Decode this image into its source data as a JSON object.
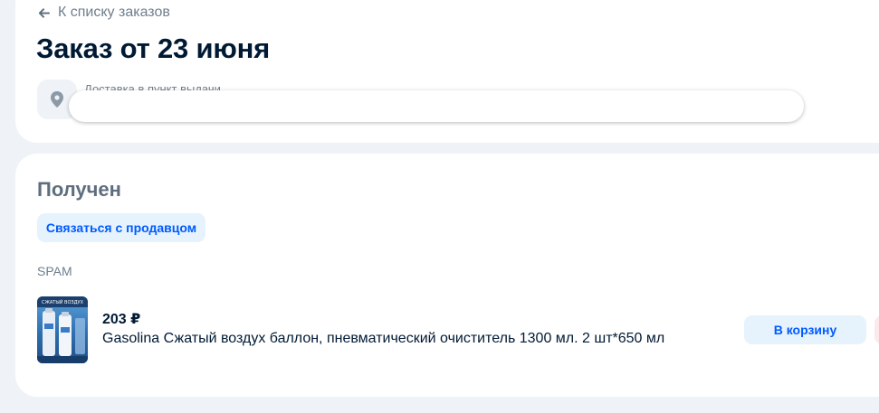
{
  "header": {
    "back_label": "К списку заказов",
    "title": "Заказ от 23 июня",
    "delivery_label": "Доставка в пункт выдачи"
  },
  "order": {
    "status": "Получен",
    "contact_seller_label": "Связаться с продавцом",
    "seller_name": "SPAM",
    "item": {
      "price": "203 ₽",
      "name": "Gasolina Сжатый воздух баллон, пневматический очиститель 1300 мл. 2 шт*650 мл",
      "cart_label": "В корзину",
      "image_caption": "СЖАТЫЙ ВОЗДУХ"
    }
  },
  "colors": {
    "background": "#eff2f6",
    "card": "#ffffff",
    "accent": "#005bff",
    "button_bg": "#e6f2fc",
    "text_primary": "#001a34",
    "text_secondary": "#707f8d"
  },
  "icons": {
    "back": "arrow-left-icon",
    "location": "map-pin-icon"
  }
}
